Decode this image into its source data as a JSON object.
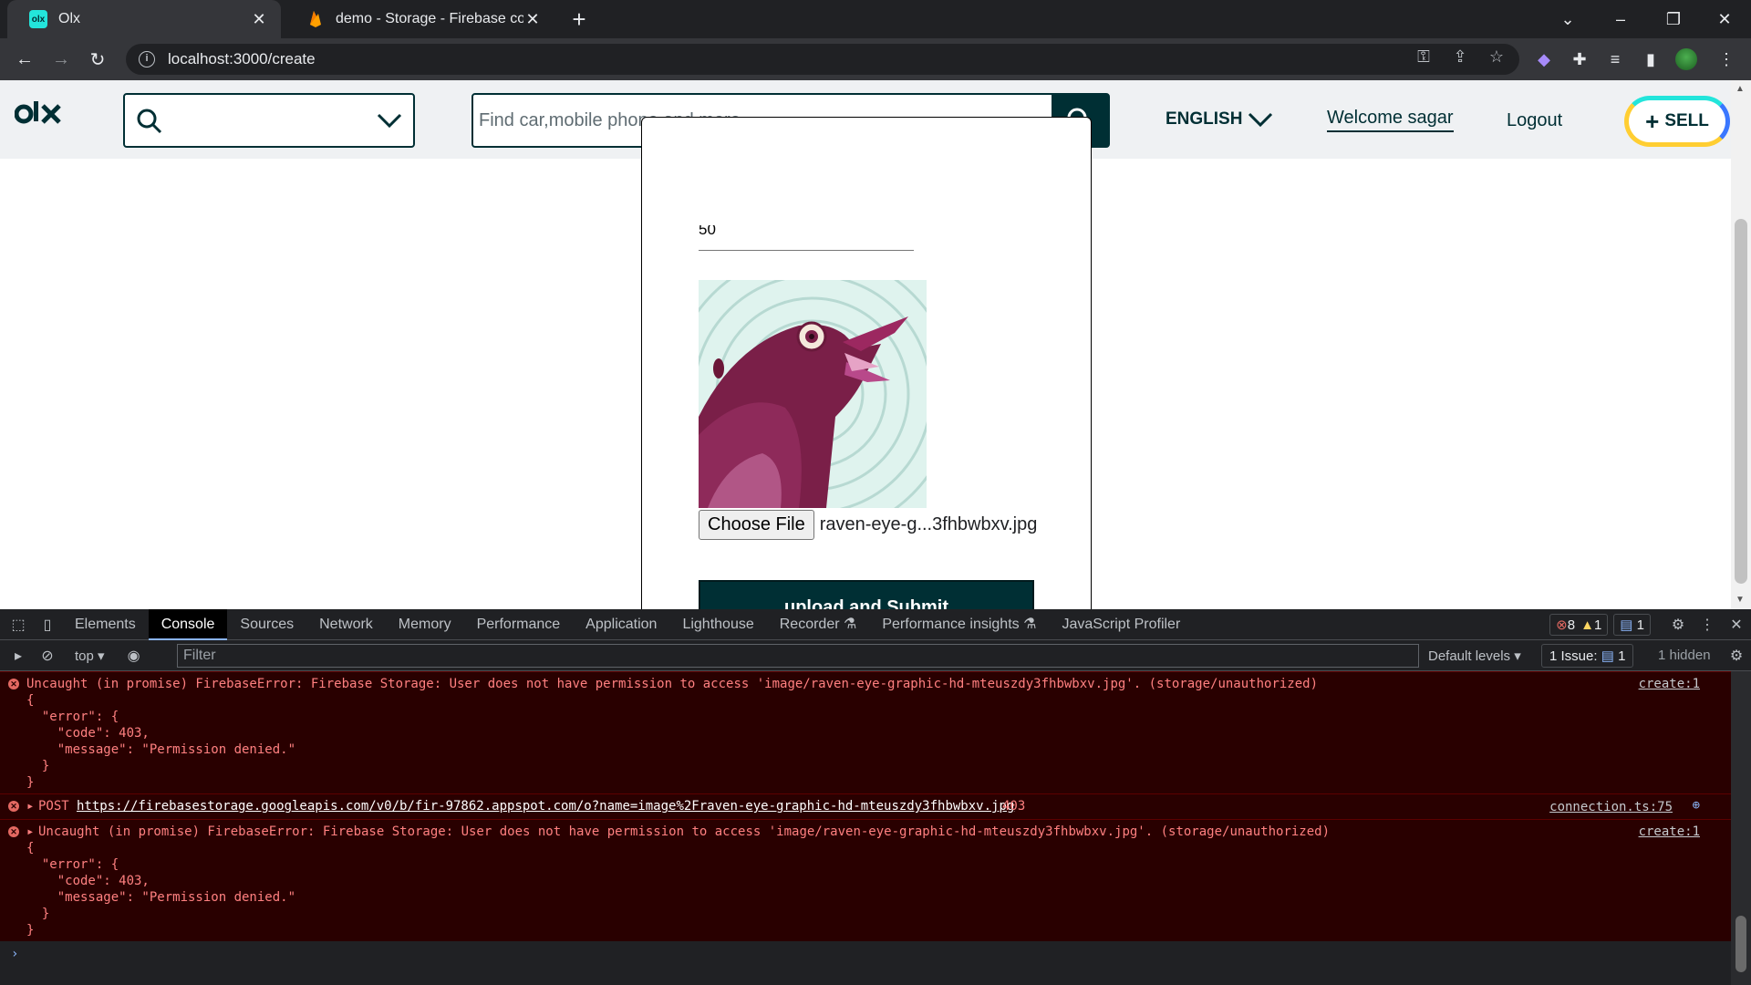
{
  "browser": {
    "tabs": [
      {
        "title": "Olx",
        "favicon": "olx-favicon",
        "active": true
      },
      {
        "title": "demo - Storage - Firebase consol",
        "favicon": "firebase-favicon",
        "active": false
      }
    ],
    "url": "localhost:3000/create"
  },
  "header": {
    "logo": "olx",
    "search_placeholder": "Find car,mobile phone and more...",
    "language": "ENGLISH",
    "welcome": "Welcome sagar",
    "logout": "Logout",
    "sell": "SELL"
  },
  "form": {
    "price_value": "50",
    "choose_file_label": "Choose File",
    "file_name": "raven-eye-g...3fhbwbxv.jpg",
    "submit_label": "upload and Submit"
  },
  "devtools": {
    "tabs": [
      "Elements",
      "Console",
      "Sources",
      "Network",
      "Memory",
      "Performance",
      "Application",
      "Lighthouse",
      "Recorder",
      "Performance insights",
      "JavaScript Profiler"
    ],
    "active_tab": "Console",
    "error_count": "8",
    "warning_count": "1",
    "info_count": "1",
    "context": "top",
    "filter_placeholder": "Filter",
    "levels": "Default levels",
    "issues_label": "1 Issue:",
    "issues_count": "1",
    "hidden": "1 hidden",
    "messages": [
      {
        "lines": [
          "Uncaught (in promise) FirebaseError: Firebase Storage: User does not have permission to access 'image/raven-eye-graphic-hd-mteuszdy3fhbwbxv.jpg'. (storage/unauthorized)",
          "{",
          "  \"error\": {",
          "    \"code\": 403,",
          "    \"message\": \"Permission denied.\"",
          "  }",
          "}"
        ],
        "source": "create:1"
      },
      {
        "method": "POST",
        "url": "https://firebasestorage.googleapis.com/v0/b/fir-97862.appspot.com/o?name=image%2Fraven-eye-graphic-hd-mteuszdy3fhbwbxv.jpg",
        "status": "403",
        "source": "connection.ts:75"
      },
      {
        "lines": [
          "Uncaught (in promise) FirebaseError: Firebase Storage: User does not have permission to access 'image/raven-eye-graphic-hd-mteuszdy3fhbwbxv.jpg'. (storage/unauthorized)",
          "{",
          "  \"error\": {",
          "    \"code\": 403,",
          "    \"message\": \"Permission denied.\"",
          "  }",
          "}"
        ],
        "source": "create:1"
      }
    ]
  },
  "colors": {
    "olx_primary": "#002f34",
    "error_bg": "#290000",
    "error_text": "#ff8080"
  }
}
